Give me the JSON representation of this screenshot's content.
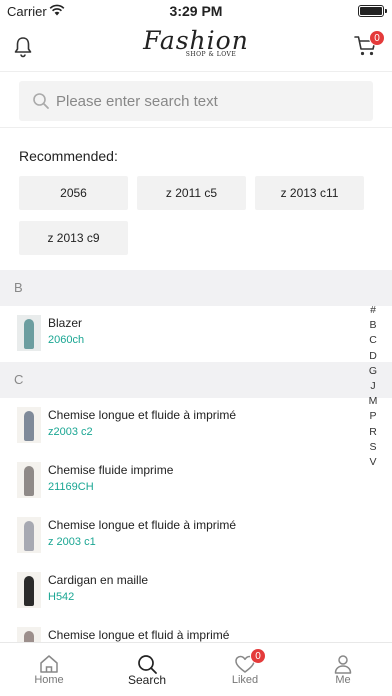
{
  "status_bar": {
    "carrier": "Carrier",
    "time": "3:29 PM"
  },
  "header": {
    "logo_text": "Fashion",
    "logo_tagline": "SHOP & LOVE",
    "cart_count": "0"
  },
  "search": {
    "placeholder": "Please enter search text",
    "value": ""
  },
  "recommended": {
    "title": "Recommended:",
    "chips": [
      "2056",
      "z 2011 c5",
      "z 2013 c11",
      "z 2013 c9"
    ]
  },
  "sections": [
    {
      "letter": "B",
      "items": [
        {
          "name": "Blazer",
          "code": "2060ch"
        }
      ]
    },
    {
      "letter": "C",
      "items": [
        {
          "name": "Chemise longue et fluide à imprimé",
          "code": "z2003 c2"
        },
        {
          "name": "Chemise fluide imprime",
          "code": "21169CH"
        },
        {
          "name": "Chemise longue et fluide à imprimé",
          "code": "z 2003 c1"
        },
        {
          "name": "Cardigan en maille",
          "code": "H542"
        },
        {
          "name": "Chemise longue et fluid à imprimé",
          "code": ""
        }
      ]
    }
  ],
  "index_letters": [
    "#",
    "B",
    "C",
    "D",
    "G",
    "J",
    "M",
    "P",
    "R",
    "S",
    "V"
  ],
  "tabs": [
    {
      "label": "Home",
      "icon": "home-icon",
      "active": false
    },
    {
      "label": "Search",
      "icon": "search-icon",
      "active": true
    },
    {
      "label": "Liked",
      "icon": "heart-icon",
      "active": false,
      "badge": "0"
    },
    {
      "label": "Me",
      "icon": "person-icon",
      "active": false
    }
  ],
  "colors": {
    "accent": "#1aa693",
    "badge": "#e43b3b",
    "section_bg": "#f1f1f3"
  }
}
